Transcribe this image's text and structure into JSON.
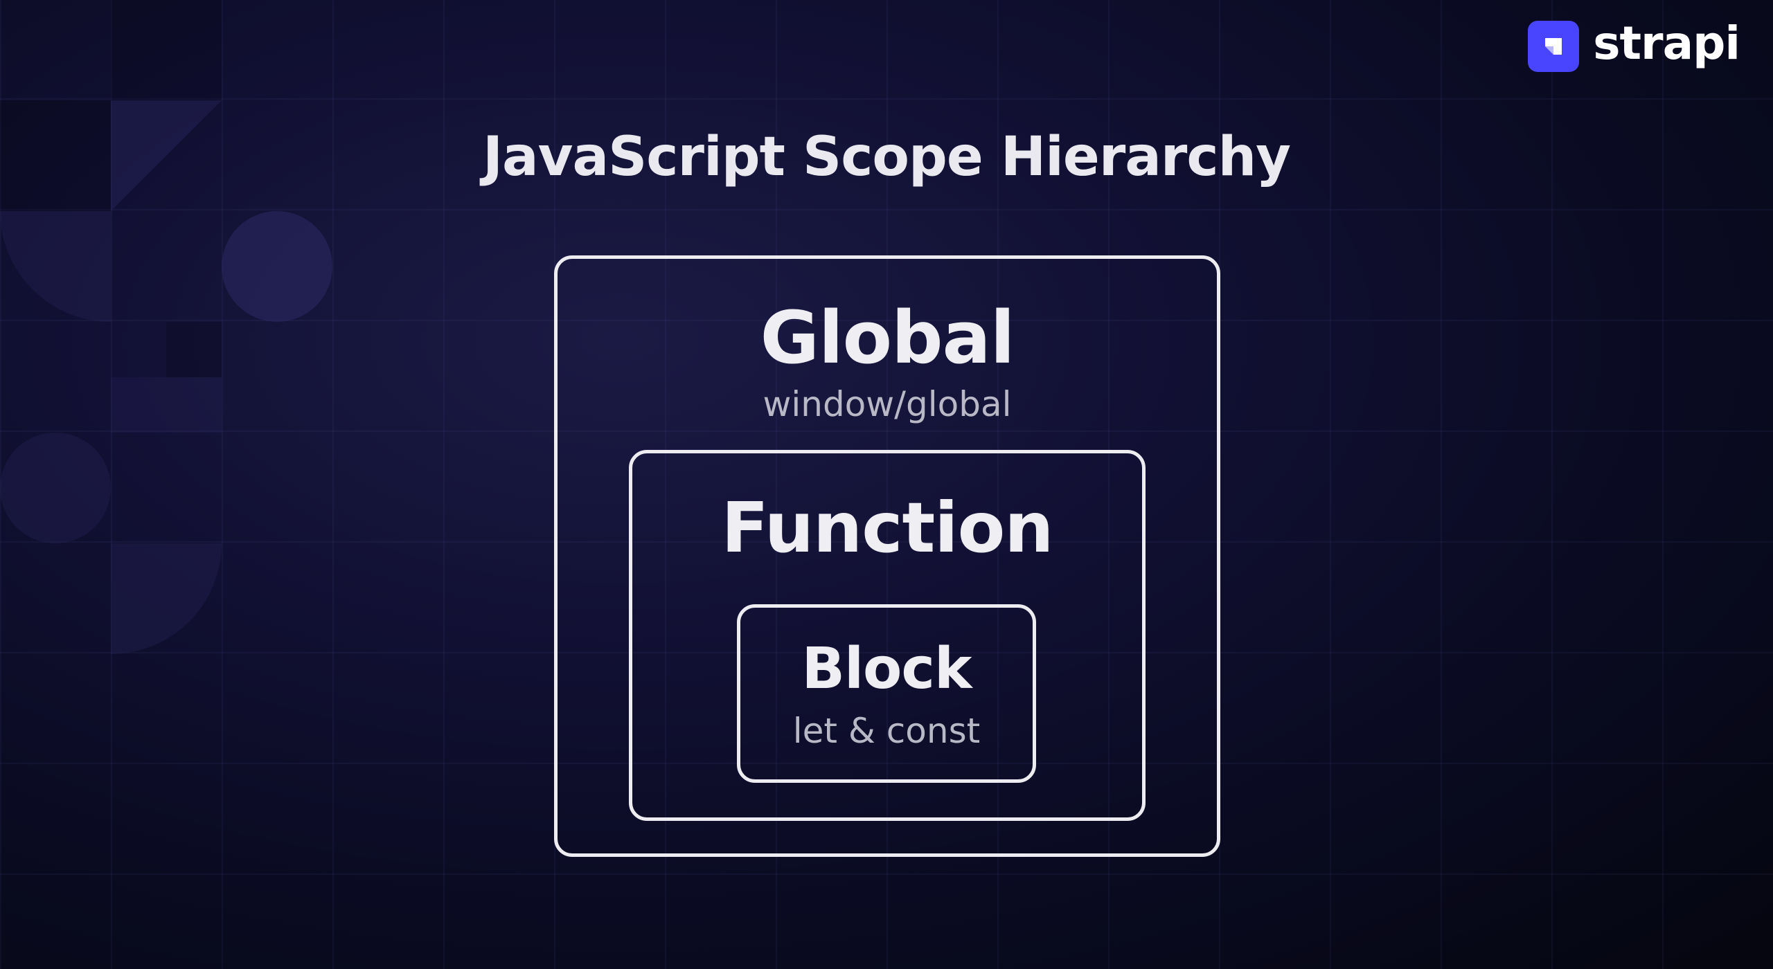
{
  "brand": {
    "name": "strapi",
    "accent_color": "#4945ff"
  },
  "title": "JavaScript Scope Hierarchy",
  "scopes": {
    "global": {
      "label": "Global",
      "subtitle": "window/global"
    },
    "function": {
      "label": "Function"
    },
    "block": {
      "label": "Block",
      "subtitle": "let & const"
    }
  }
}
